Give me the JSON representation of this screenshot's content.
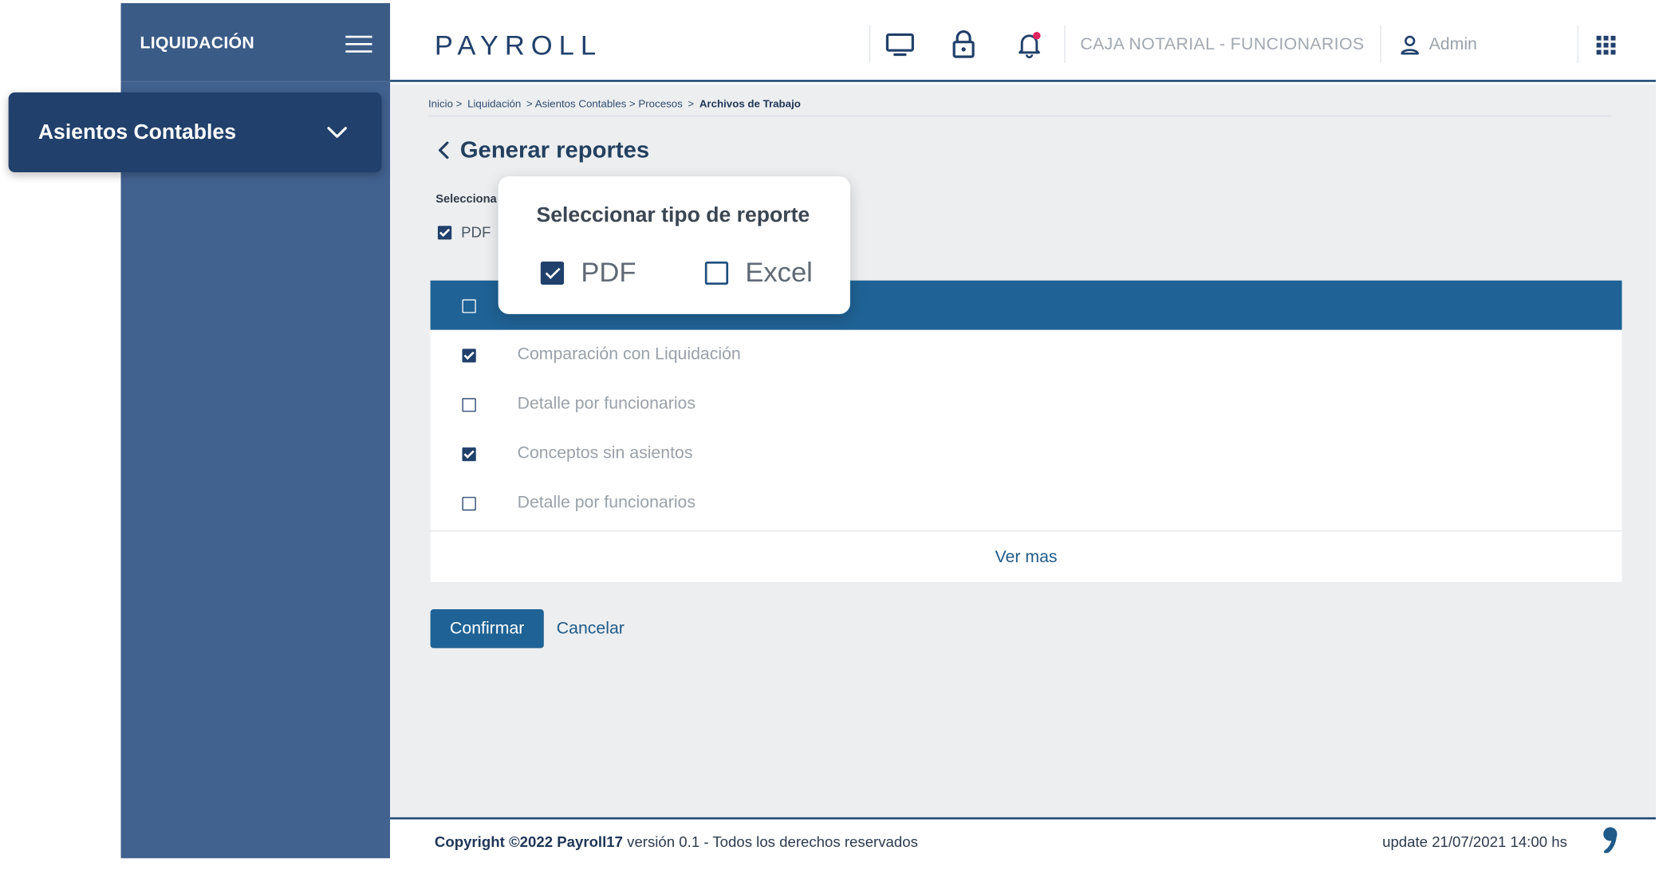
{
  "sidebar": {
    "title": "LIQUIDACIÓN",
    "section_label": "Asientos Contables"
  },
  "header": {
    "logo": "PAYROLL",
    "company": "CAJA NOTARIAL - FUNCIONARIOS",
    "user": "Admin",
    "icons": [
      "monitor-icon",
      "lock-icon",
      "bell-icon",
      "user-icon",
      "apps-grid-icon"
    ],
    "notification_dot_color": "#e0245e"
  },
  "breadcrumb": {
    "items": [
      "Inicio >",
      "Liquidación",
      "> Asientos Contables > Procesos",
      ">"
    ],
    "current": "Archivos de Trabajo"
  },
  "page": {
    "title": "Generar reportes",
    "select_label": "Selecciona",
    "small_pdf_label": "PDF"
  },
  "popover": {
    "title": "Seleccionar tipo de reporte",
    "options": [
      {
        "label": "PDF",
        "checked": true
      },
      {
        "label": "Excel",
        "checked": false
      }
    ]
  },
  "table": {
    "header_checked": false,
    "rows": [
      {
        "label": "Comparación con Liquidación",
        "checked": true
      },
      {
        "label": "Detalle por funcionarios",
        "checked": false
      },
      {
        "label": "Conceptos sin asientos",
        "checked": true
      },
      {
        "label": "Detalle por funcionarios",
        "checked": false
      }
    ],
    "more": "Ver mas"
  },
  "actions": {
    "confirm": "Confirmar",
    "cancel": "Cancelar"
  },
  "footer": {
    "copyright_bold": "Copyright ©2022 Payroll17",
    "copyright_rest": " versión 0.1 - Todos los derechos reservados",
    "update": "update 21/07/2021 14:00 hs"
  },
  "colors": {
    "sidebar": "#41618f",
    "section_card": "#21406b",
    "table_header": "#1f6295",
    "accent": "#1f5a88"
  }
}
